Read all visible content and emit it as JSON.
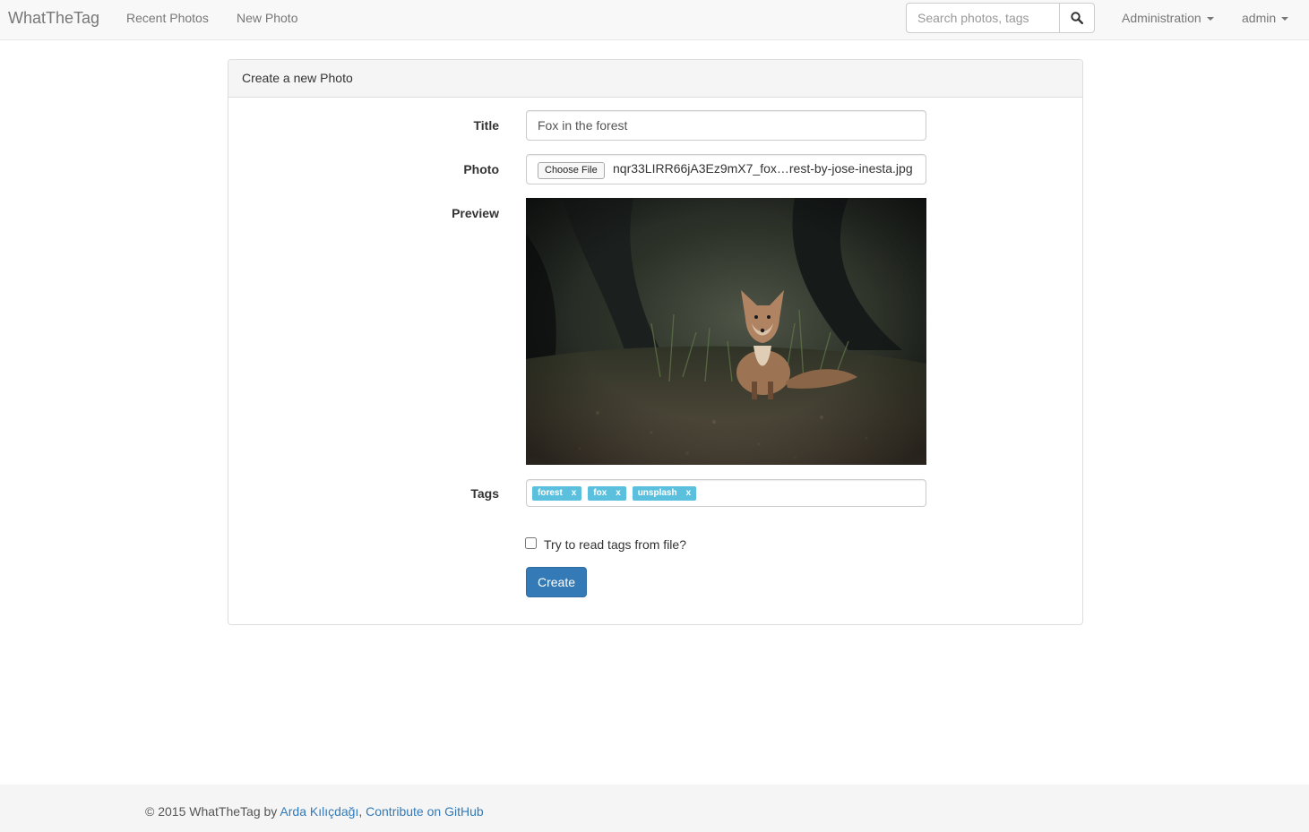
{
  "navbar": {
    "brand": "WhatTheTag",
    "links": [
      "Recent Photos",
      "New Photo"
    ],
    "search_placeholder": "Search photos, tags",
    "admin_menu": "Administration",
    "user_menu": "admin"
  },
  "panel": {
    "heading": "Create a new Photo"
  },
  "form": {
    "title_label": "Title",
    "title_value": "Fox in the forest",
    "photo_label": "Photo",
    "choose_file_label": "Choose File",
    "file_name": "nqr33LIRR66jA3Ez9mX7_fox…rest-by-jose-inesta.jpg",
    "preview_label": "Preview",
    "tags_label": "Tags",
    "tags": [
      "forest",
      "fox",
      "unsplash"
    ],
    "tag_remove_symbol": "x",
    "read_tags_label": "Try to read tags from file?",
    "read_tags_checked": false,
    "submit_label": "Create"
  },
  "footer": {
    "prefix": "© 2015 WhatTheTag by ",
    "author": "Arda Kılıçdağı",
    "separator": ", ",
    "github_link": "Contribute on GitHub"
  },
  "colors": {
    "primary": "#337ab7",
    "tag": "#5bc0de",
    "navbar_bg": "#f8f8f8"
  }
}
